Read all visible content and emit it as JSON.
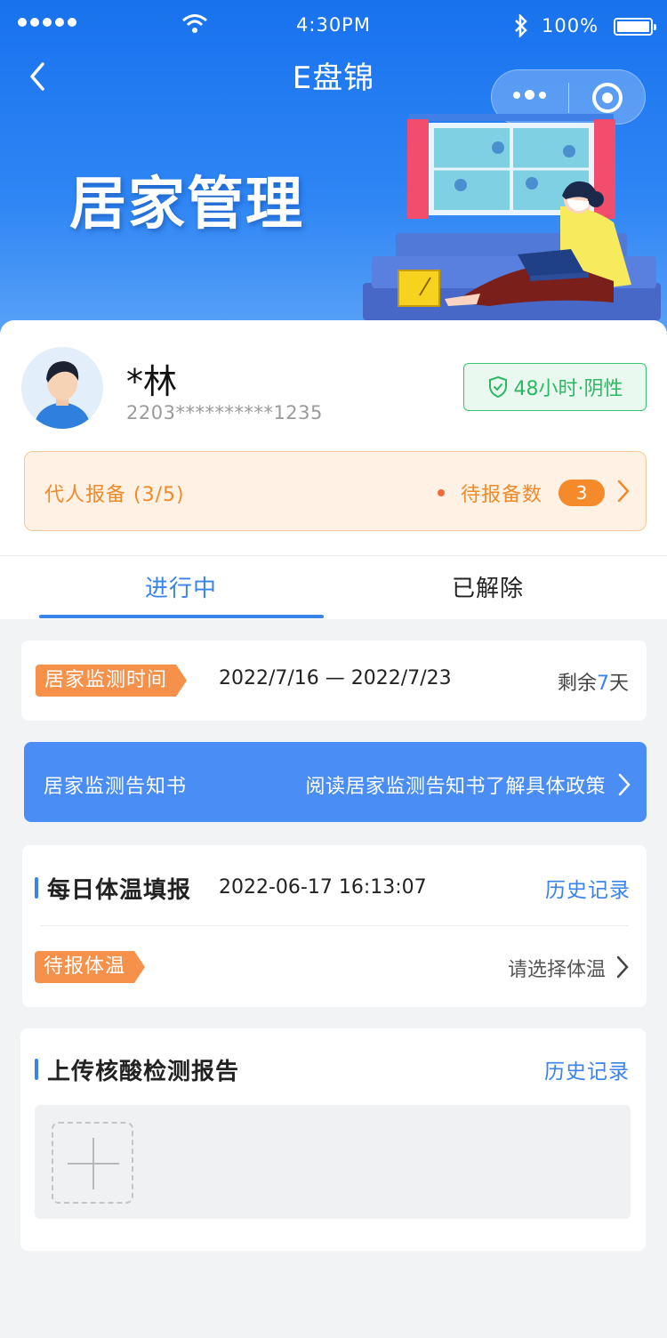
{
  "status_bar": {
    "time": "4:30PM",
    "battery": "100%"
  },
  "nav": {
    "title": "E盘锦"
  },
  "banner": {
    "title": "居家管理"
  },
  "user": {
    "name": "*林",
    "id_number": "2203**********1235",
    "test_status": "48小时·阴性"
  },
  "proxy_report": {
    "label": "代人报备 (3/5)",
    "pending_label": "待报备数",
    "pending_count": "3"
  },
  "tabs": [
    {
      "label": "进行中",
      "active": true
    },
    {
      "label": "已解除",
      "active": false
    }
  ],
  "monitoring": {
    "tag": "居家监测时间",
    "date_range": "2022/7/16 — 2022/7/23",
    "remaining_prefix": "剩余",
    "remaining_days": "7",
    "remaining_suffix": "天"
  },
  "notice": {
    "title": "居家监测告知书",
    "description": "阅读居家监测告知书了解具体政策"
  },
  "temperature": {
    "title": "每日体温填报",
    "datetime": "2022-06-17  16:13:07",
    "history": "历史记录",
    "tag": "待报体温",
    "select_placeholder": "请选择体温"
  },
  "nucleic_upload": {
    "title": "上传核酸检测报告",
    "history": "历史记录"
  },
  "colors": {
    "primary": "#3a83ea",
    "orange": "#f5914a",
    "green": "#2db862",
    "banner_blue": "#1872ee"
  },
  "icons": [
    "back-chevron",
    "more-dots",
    "close-target",
    "shield-check",
    "chevron-right",
    "plus"
  ]
}
